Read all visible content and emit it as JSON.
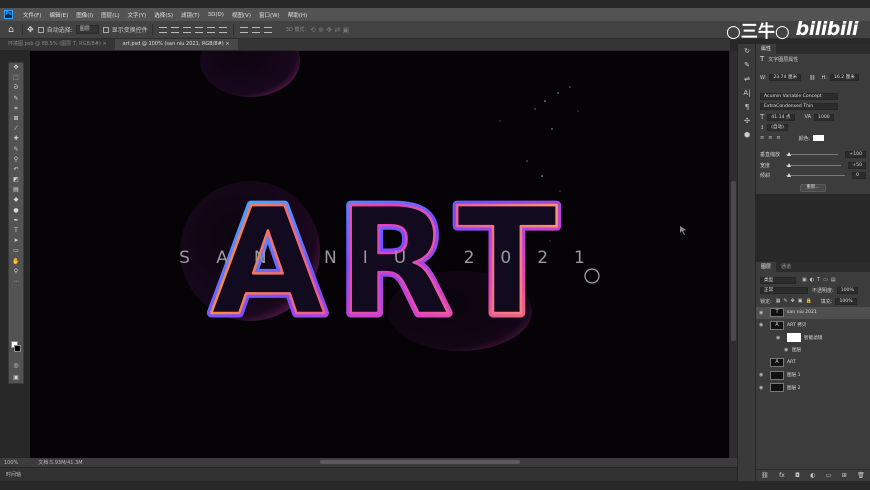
{
  "app": {
    "logo": "Ps"
  },
  "menu": [
    "文件(F)",
    "编辑(E)",
    "图像(I)",
    "图层(L)",
    "文字(Y)",
    "选择(S)",
    "滤镜(T)",
    "3D(D)",
    "视图(V)",
    "窗口(W)",
    "帮助(H)"
  ],
  "options": {
    "home_icon": "home-icon",
    "auto_select_label": "自动选择:",
    "auto_select_value": "图层",
    "show_transform_label": "显示变换控件",
    "mode_3d_label": "3D 模式:"
  },
  "tabs": [
    {
      "label": "环境图.psb @ 88.5% (图层 7, RGB/8#) ×",
      "active": false
    },
    {
      "label": "art.psd @ 100% (san niu 2021, RGB/8#) ×",
      "active": true
    }
  ],
  "canvas": {
    "main_text": "ART",
    "sub_text": "SAN NIU 2021"
  },
  "status": {
    "zoom": "100%",
    "doc": "文档:5.93M/41.3M",
    "timeline": "时间轴"
  },
  "watermark": {
    "cn": "○三牛○",
    "en": "bilibili"
  },
  "properties": {
    "tab": "属性",
    "header": "文字图层属性",
    "w_label": "W:",
    "w_value": "23.74 厘米",
    "h_label": "H:",
    "h_value": "16.2 厘米",
    "font_family": "Acumin Variable Concept",
    "font_style": "ExtraCondensed Thin",
    "font_size": "41.14 点",
    "tracking": "1000",
    "leading": "(自动)",
    "color_label": "颜色:",
    "horizontal_scale_label": "垂直缩放",
    "horizontal_scale_value": "+100",
    "width_label": "宽度",
    "width_value": "+50",
    "slant_label": "倾斜",
    "slant_value": "0",
    "reset_button": "重新..."
  },
  "layers_panel": {
    "tabs": [
      "图层",
      "通道"
    ],
    "kind_filter": "类型",
    "blend_mode": "正常",
    "opacity_label": "不透明度:",
    "opacity_value": "100%",
    "lock_label": "锁定:",
    "fill_label": "填充:",
    "fill_value": "100%",
    "layers": [
      {
        "name": "san niu 2021",
        "thumb": "T",
        "selected": true
      },
      {
        "name": "ART 拷贝",
        "thumb": "A",
        "selected": false
      },
      {
        "name": "智能滤镜",
        "thumb": "",
        "selected": false
      },
      {
        "name": "图层",
        "thumb": "",
        "selected": false
      },
      {
        "name": "ART",
        "thumb": "A",
        "selected": false
      },
      {
        "name": "图层 1",
        "thumb": "",
        "selected": false
      },
      {
        "name": "图层 2",
        "thumb": "",
        "selected": false
      }
    ]
  },
  "colors": {
    "accent_cyan": "#35c8ff",
    "accent_magenta": "#e040c0",
    "accent_orange": "#ff8a3a",
    "accent_purple": "#7a4cff"
  }
}
